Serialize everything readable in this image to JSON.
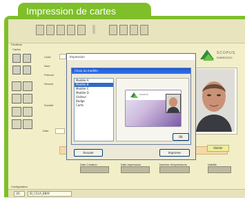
{
  "header": {
    "tab_label": "Impression de cartes"
  },
  "brand": {
    "logo_line1": "SCOPUS",
    "logo_line2": "EMBEDDED"
  },
  "toolbar": {
    "icons": [
      "print-icon",
      "print-icon",
      "print-icon",
      "print-icon",
      "print-icon",
      "separator",
      "card-icon",
      "card-icon",
      "card-icon",
      "card-icon"
    ]
  },
  "left_panel": {
    "top_label": "Pavillons",
    "section_label": "Cartes",
    "bottom_label": "Configuration"
  },
  "form": {
    "labels": [
      "Code",
      "Nom",
      "Prénom",
      "Service",
      "Société",
      "Date"
    ],
    "bottom_labels": [
      "Date Création",
      "Date Impression",
      "Nombre d'impressions",
      "Validité"
    ]
  },
  "dialog": {
    "title": "Impression",
    "inner_title": "Choix du modèle",
    "list_items": [
      "",
      "Modèle A",
      "Modèle B",
      "Modèle C",
      "Modèle D",
      "Visiteur",
      "Badge",
      "Carte"
    ],
    "selected_index": 2,
    "card_logo": "SCOPUS",
    "btn_left": "Annuler",
    "btn_right": "Imprimer",
    "btn_ok": "OK"
  },
  "right_actions": {
    "btn_label": "Valider"
  },
  "status": {
    "field1": "Uti.",
    "field2": "ID_CS1A_BBAF"
  },
  "colors": {
    "accent_green": "#7fbf2a",
    "panel_bg": "#f1eec8",
    "titlebar_blue": "#1a5bd9"
  }
}
